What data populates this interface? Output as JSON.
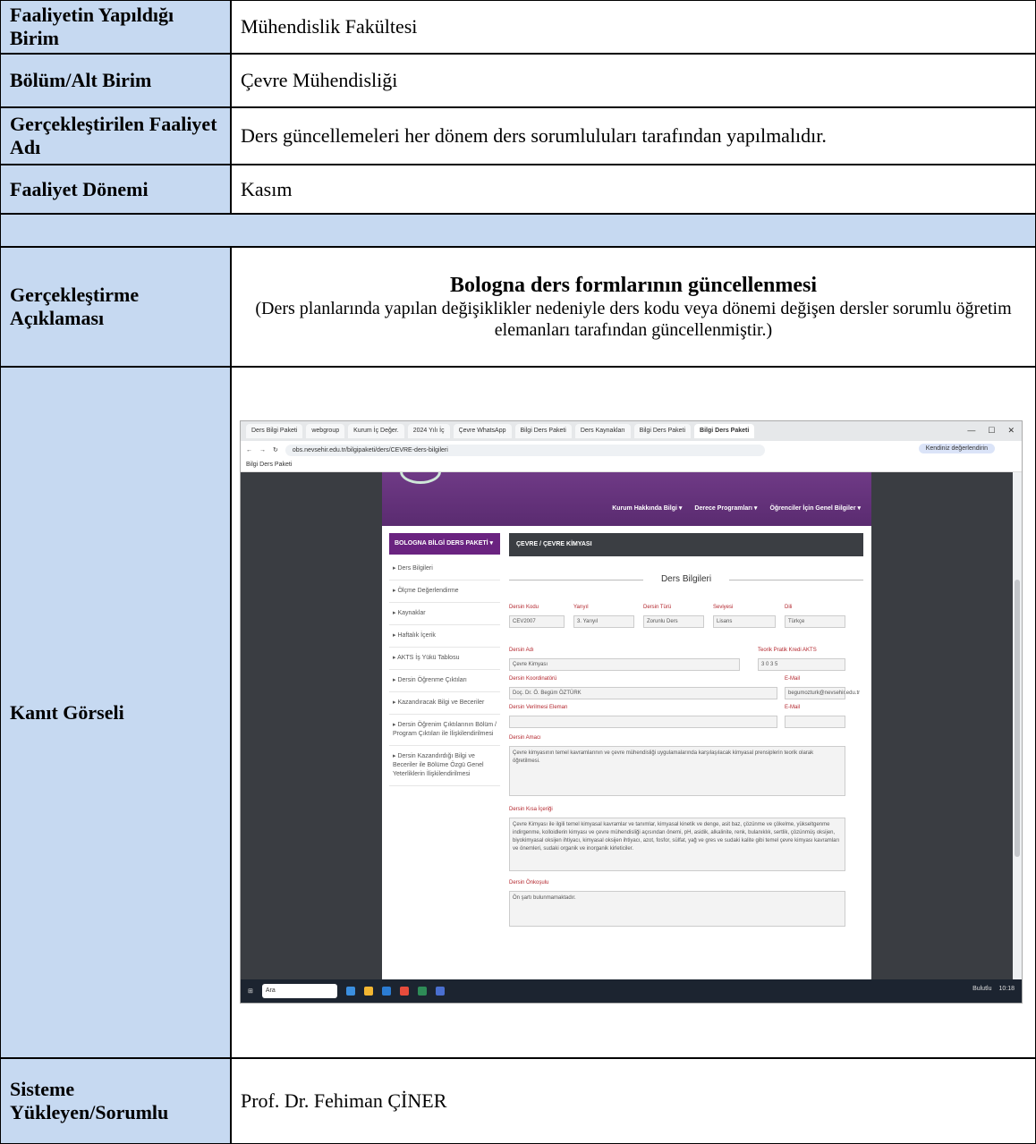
{
  "rows": [
    {
      "label": "Faaliyetin Yapıldığı Birim",
      "value": "Mühendislik Fakültesi"
    },
    {
      "label": "Bölüm/Alt Birim",
      "value": "Çevre Mühendisliği"
    },
    {
      "label": "Gerçekleştirilen Faaliyet Adı",
      "value": "Ders güncellemeleri her dönem ders sorumluluları tarafından yapılmalıdır."
    },
    {
      "label": "Faaliyet Dönemi",
      "value": "Kasım"
    }
  ],
  "explanation": {
    "label": "Gerçekleştirme Açıklaması",
    "title": "Bologna ders formlarının güncellenmesi",
    "detail": "(Ders planlarında yapılan değişiklikler nedeniyle ders kodu veya dönemi değişen dersler sorumlu öğretim elemanları tarafından güncellenmiştir.)"
  },
  "evidence": {
    "label": "Kanıt Görseli"
  },
  "uploader": {
    "label": "Sisteme Yükleyen/Sorumlu",
    "value": "Prof. Dr. Fehiman ÇİNER"
  },
  "screenshot": {
    "tabs": [
      "Ders Bilgi Paketi",
      "webgroup",
      "Kurum İç Değer.",
      "2024 Yılı İç",
      "Çevre WhatsApp",
      "Bilgi Ders Paketi",
      "Ders Kaynakları",
      "Bilgi Ders Paketi",
      "Bilgi Ders Paketi"
    ],
    "url": "obs.nevsehir.edu.tr/bilgipaketi/ders/CEVRE-ders-bilgileri",
    "profile": "Kendiniz değerlendirin",
    "bookmark": "Bilgi Ders Paketi",
    "nav": [
      "Kurum Hakkında Bilgi ▾",
      "Derece Programları ▾",
      "Öğrenciler İçin Genel Bilgiler ▾"
    ],
    "side_title": "BOLOGNA BİLGİ DERS PAKETİ ▾",
    "side_items": [
      "▸ Ders Bilgileri",
      "▸ Ölçme Değerlendirme",
      "▸ Kaynaklar",
      "▸ Haftalık İçerik",
      "▸ AKTS İş Yükü Tablosu",
      "▸ Dersin Öğrenme Çıktıları",
      "▸ Kazandıracak Bilgi ve Beceriler",
      "▸ Dersin Öğrenim Çıktılarının Bölüm / Program Çıktıları ile İlişkilendirilmesi",
      "▸ Dersin Kazandırdığı Bilgi ve Beceriler ile Bölüme Özgü Genel Yeterliklerin İlişkilendirilmesi"
    ],
    "main_title": "ÇEVRE / ÇEVRE KİMYASI",
    "section": "Ders Bilgileri",
    "f_code": "Dersin Kodu",
    "v_code": "CEV2007",
    "f_year": "Yarıyıl",
    "v_year": "3. Yarıyıl",
    "f_type": "Dersin Türü",
    "v_type": "Zorunlu Ders",
    "f_level": "Seviyesi",
    "v_level": "Lisans",
    "f_lang": "Dili",
    "v_lang": "Türkçe",
    "f_name": "Dersin Adı",
    "v_name": "Çevre Kimyası",
    "f_hours": "Teorik  Pratik  Kredi  AKTS",
    "v_hours": "3   0   3   5",
    "f_coord": "Dersin Koordinatörü",
    "v_coord": "Doç. Dr. Ö. Begüm ÖZTÜRK",
    "f_mail": "E-Mail",
    "v_mail": "begumozturk@nevsehir.edu.tr",
    "f_staff": "Dersin Verilmesi Eleman",
    "f_mail2": "E-Mail",
    "f_aim": "Dersin Amacı",
    "v_aim": "Çevre kimyasının temel kavramlarının ve çevre mühendisliği uygulamalarında karşılaşılacak kimyasal prensiplerin teorik olarak öğretilmesi.",
    "f_content": "Dersin Kısa İçeriği",
    "v_content": "Çevre Kimyası ile ilgili temel kimyasal kavramlar ve tanımlar, kimyasal kinetik ve denge, asit baz, çözünme ve çökelme, yükseltgenme indirgenme, kolloidlerin kimyası ve çevre mühendisliği açısından önemi, pH, asidik, alkalinite, renk, bulanıklık, sertlik, çözünmüş oksijen, biyokimyasal oksijen ihtiyacı, kimyasal oksijen ihtiyacı, azot, fosfor, sülfat, yağ ve gres ve sudaki kalite gibi temel çevre kimyası kavramları ve önemleri, sudaki organik ve inorganik kirleticiler.",
    "f_pre": "Dersin Önkoşulu",
    "v_pre": "Ön şartı bulunmamaktadır.",
    "search": "Ara",
    "weather": "Bulutlu",
    "clock": "10:18"
  }
}
